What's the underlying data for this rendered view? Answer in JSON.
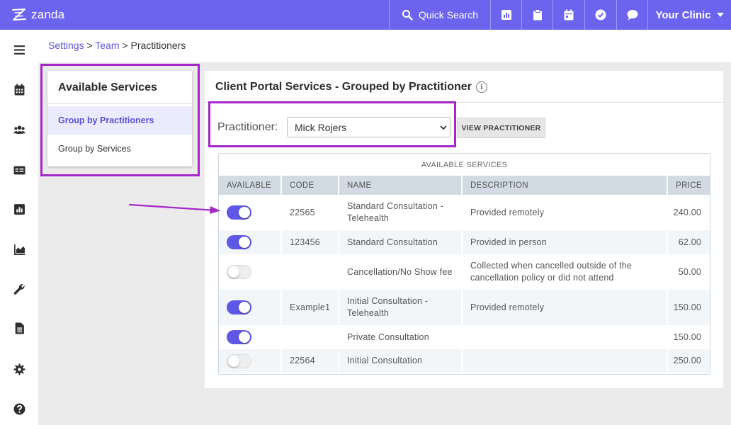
{
  "brand": {
    "name": "zanda"
  },
  "topbar": {
    "search_label": "Quick Search",
    "clinic_label": "Your Clinic",
    "icons": [
      "search-icon",
      "report-icon",
      "clipboard-icon",
      "calendar-icon",
      "check-circle-icon",
      "chat-icon"
    ]
  },
  "sidebar": {
    "icons": [
      "menu-icon",
      "calendar-icon",
      "users-icon",
      "id-card-icon",
      "report-icon",
      "area-chart-icon",
      "wrench-icon",
      "document-icon",
      "gear-icon",
      "help-icon"
    ]
  },
  "breadcrumb": {
    "settings": "Settings",
    "sep1": " > ",
    "team": "Team",
    "sep2": " > ",
    "current": "Practitioners"
  },
  "left_panel": {
    "title": "Available Services",
    "items": [
      {
        "label": "Group by Practitioners",
        "active": true
      },
      {
        "label": "Group by Services",
        "active": false
      }
    ]
  },
  "main": {
    "title": "Client Portal Services - Grouped by Practitioner",
    "info_glyph": "i",
    "practitioner_label": "Practitioner:",
    "practitioner_value": "Mick Rojers",
    "view_button": "VIEW PRACTITIONER",
    "table": {
      "caption": "AVAILABLE SERVICES",
      "headers": {
        "available": "AVAILABLE",
        "code": "CODE",
        "name": "NAME",
        "description": "DESCRIPTION",
        "price": "PRICE"
      },
      "rows": [
        {
          "available": true,
          "code": "22565",
          "name": "Standard Consultation - Telehealth",
          "description": "Provided remotely",
          "price": "240.00"
        },
        {
          "available": true,
          "code": "123456",
          "name": "Standard Consultation",
          "description": "Provided in person",
          "price": "62.00"
        },
        {
          "available": false,
          "code": "",
          "name": "Cancellation/No Show fee",
          "description": "Collected when cancelled outside of the cancellation policy or did not attend",
          "price": "50.00"
        },
        {
          "available": true,
          "code": "Example1",
          "name": "Initial Consultation - Telehealth",
          "description": "Provided remotely",
          "price": "150.00"
        },
        {
          "available": true,
          "code": "",
          "name": "Private Consultation",
          "description": "",
          "price": "150.00"
        },
        {
          "available": false,
          "code": "22564",
          "name": "Initial Consultation",
          "description": "",
          "price": "250.00"
        }
      ]
    }
  },
  "colors": {
    "brand": "#6c63ef",
    "toggle_on": "#5f58e6",
    "highlight": "#a526c9",
    "link": "#5c55d6"
  }
}
